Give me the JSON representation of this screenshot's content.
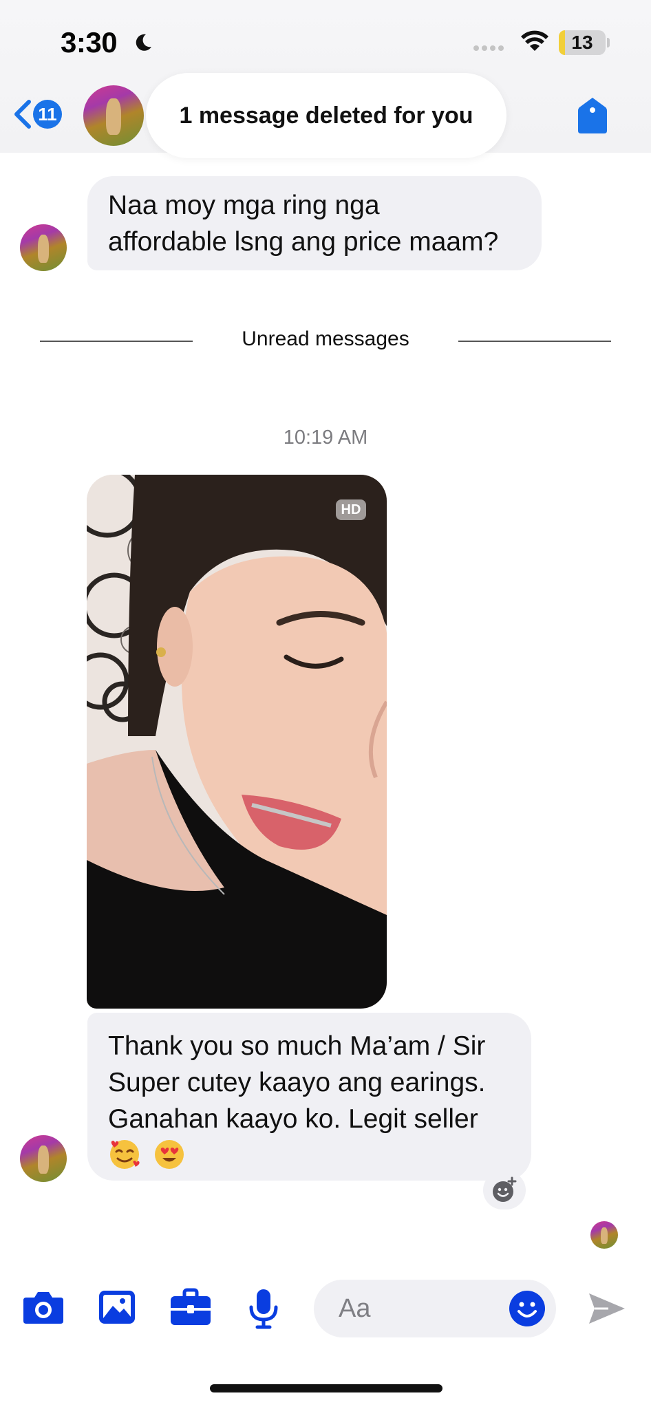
{
  "status_bar": {
    "time": "3:30",
    "battery_level": "13",
    "battery_fraction": 0.13,
    "focus_icon": "moon-icon",
    "wifi_icon": "wifi-icon"
  },
  "header": {
    "back_count": "11",
    "toast_text": "1 message deleted for you",
    "right_icon": "tag-icon"
  },
  "messages": [
    {
      "text_lines": [
        "Naa moy mga ring nga",
        "affordable lsng ang price maam?"
      ]
    },
    {
      "text_lines": [
        "Thank you so much Ma’am / Sir",
        "Super cutey kaayo ang earings.",
        "Ganahan kaayo ko. Legit seller"
      ],
      "emojis": [
        "smiling-face-with-hearts-emoji",
        "heart-eyes-emoji"
      ]
    }
  ],
  "divider": {
    "label": "Unread messages"
  },
  "timestamp": "10:19 AM",
  "photo": {
    "badge": "HD"
  },
  "composer": {
    "placeholder": "Aa",
    "icons": [
      "camera-icon",
      "gallery-icon",
      "briefcase-icon",
      "mic-icon",
      "smile-icon",
      "send-icon"
    ]
  },
  "colors": {
    "accent": "#0a3de0",
    "back_badge": "#1a73e8",
    "bubble": "#f0f0f4",
    "battery_fill": "#f1cf3a"
  }
}
